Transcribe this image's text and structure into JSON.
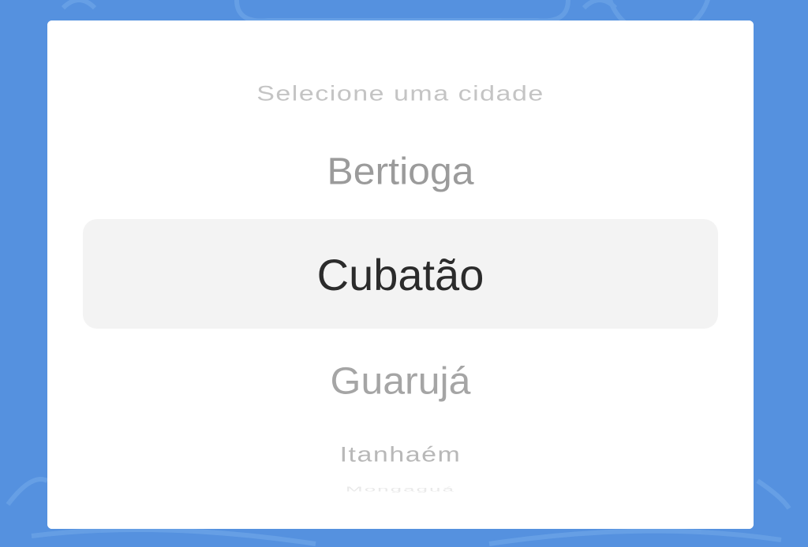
{
  "colors": {
    "backdrop": "#5591df",
    "sheet": "#ffffff",
    "selection_band": "#f3f3f3",
    "selected_text": "#2b2b2b",
    "unselected_text": "#9b9b9b",
    "placeholder_text": "#c4c4c4"
  },
  "city_picker": {
    "placeholder": "Selecione uma cidade",
    "options": [
      "Bertioga",
      "Cubatão",
      "Guarujá",
      "Itanhaém",
      "Mongaguá"
    ],
    "selected_value": "Cubatão"
  }
}
